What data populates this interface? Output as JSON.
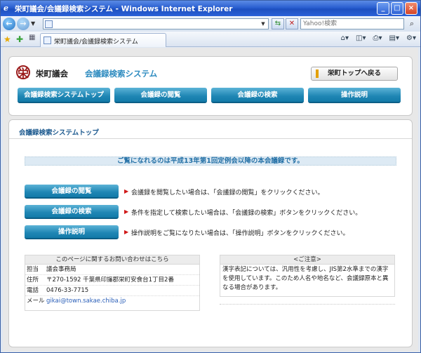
{
  "window": {
    "title": "栄町議会/会議録検索システム - Windows Internet Explorer"
  },
  "addressbar": {
    "search_placeholder": "Yahoo!検索"
  },
  "tabbar": {
    "tab_label": "栄町議会/会議録検索システム"
  },
  "header": {
    "org_name": "栄町議会",
    "system_name": "会議録検索システム",
    "top_button": "栄町トップへ戻る"
  },
  "nav": {
    "items": [
      {
        "label": "会議録検索システムトップ"
      },
      {
        "label": "会議録の閲覧"
      },
      {
        "label": "会議録の検索"
      },
      {
        "label": "操作説明"
      }
    ]
  },
  "main": {
    "section_title": "会議録検索システムトップ",
    "notice": "ご覧になれるのは平成13年第1回定例会以降の本会議録です。",
    "actions": [
      {
        "label": "会議録の閲覧",
        "desc": "会議録を閲覧したい場合は、「会議録の閲覧」をクリックください。"
      },
      {
        "label": "会議録の検索",
        "desc": "条件を指定して検索したい場合は、「会議録の検索」ボタンをクリックください。"
      },
      {
        "label": "操作説明",
        "desc": "操作説明をご覧になりたい場合は、「操作説明」ボタンをクリックください。"
      }
    ]
  },
  "contact": {
    "heading": "このページに関するお問い合わせはこちら",
    "rows": [
      {
        "label": "担当",
        "value": "議会事務局"
      },
      {
        "label": "住所",
        "value": "〒270-1592 千葉県印旛郡栄町安食台1丁目2番"
      },
      {
        "label": "電話",
        "value": "0476-33-7715"
      }
    ],
    "email_label": "メール",
    "email": "gikai@town.sakae.chiba.jp"
  },
  "note": {
    "heading": "<ご注意>",
    "body": "漢字表記については、汎用性を考慮し、JIS第2水準までの漢字を使用しています。このため人名や地名など、会議録原本と異なる場合があります。"
  },
  "colors": {
    "accent": "#1f86b4",
    "notice_text": "#2370a6",
    "section_title": "#1d5a8f",
    "arrow": "#d01818"
  }
}
